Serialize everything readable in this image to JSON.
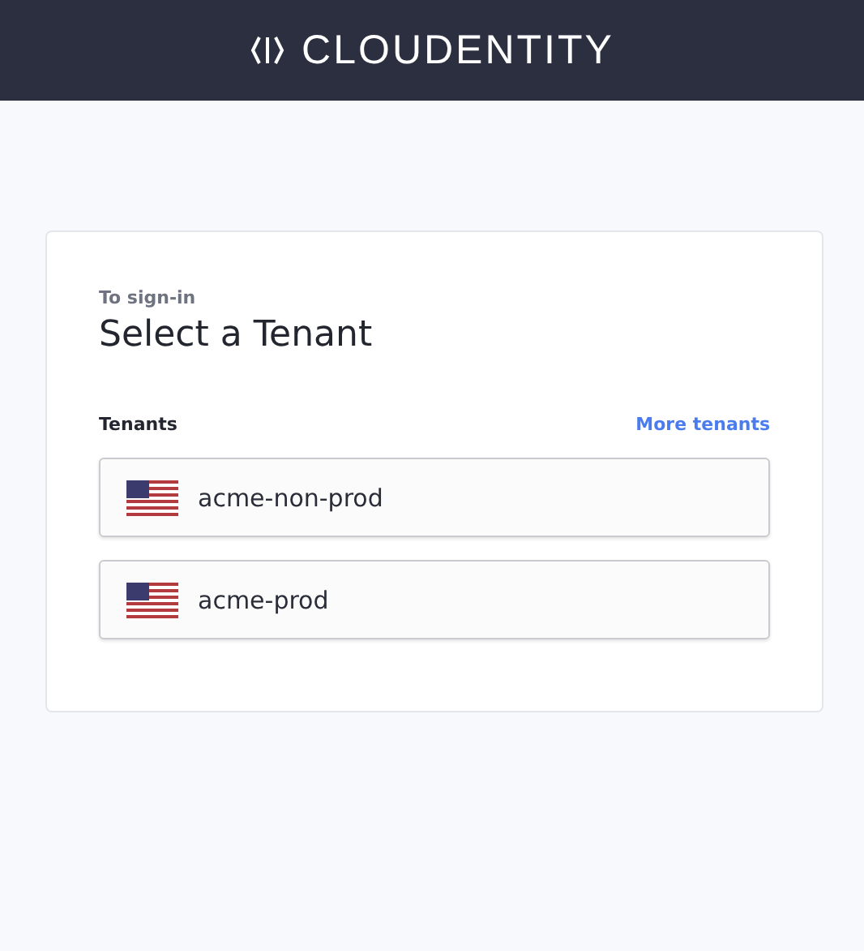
{
  "header": {
    "logo_text": "CLOUDENTITY"
  },
  "card": {
    "subtitle": "To sign-in",
    "title": "Select a Tenant",
    "list_label": "Tenants",
    "more_link": "More tenants",
    "tenants": [
      {
        "name": "acme-non-prod"
      },
      {
        "name": "acme-prod"
      }
    ]
  }
}
